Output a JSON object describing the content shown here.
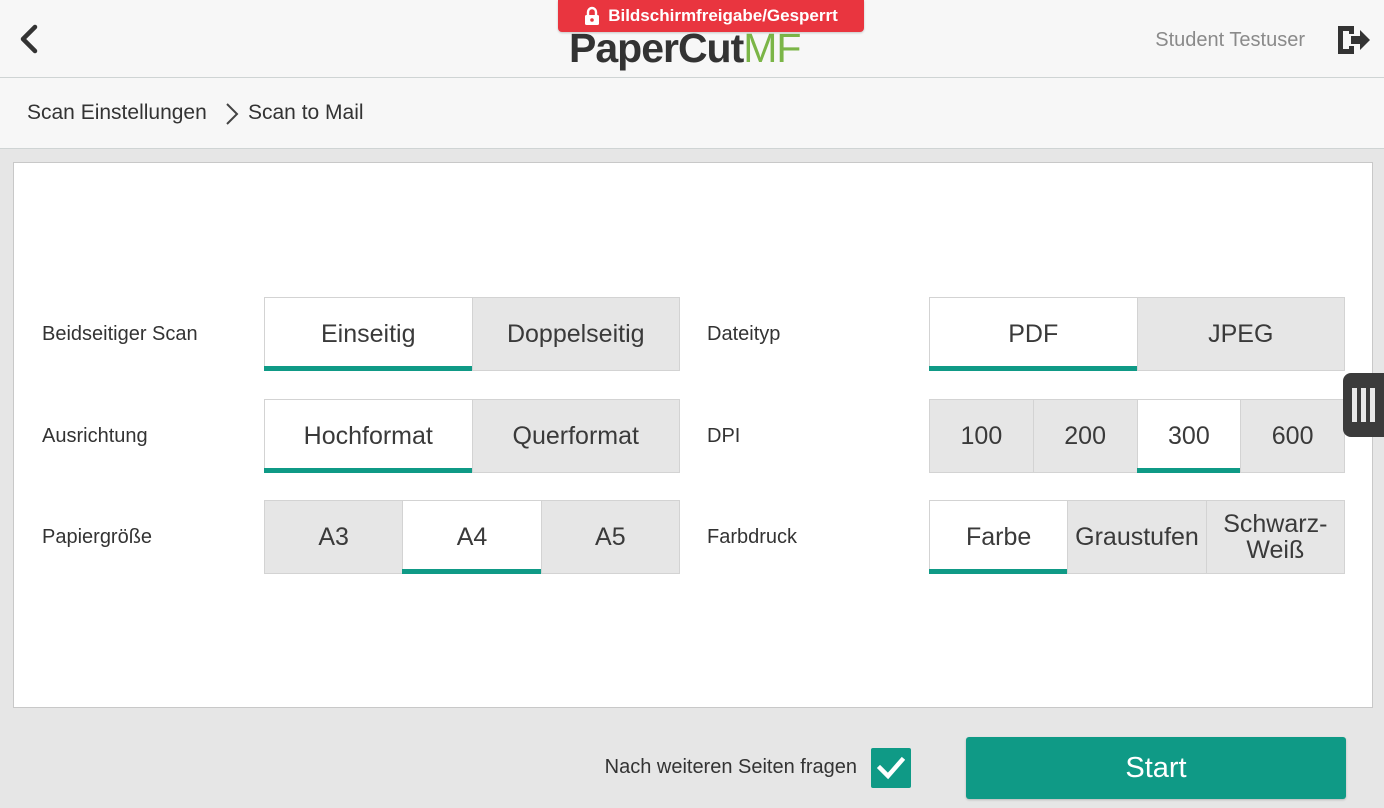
{
  "header": {
    "logo_main": "PaperCut",
    "logo_suffix": "MF",
    "lock_banner": "Bildschirmfreigabe/Gesperrt",
    "user_name": "Student Testuser",
    "icons": {
      "back": "chevron-left-icon",
      "lock": "lock-icon",
      "logout": "logout-icon"
    }
  },
  "breadcrumb": {
    "items": [
      "Scan Einstellungen",
      "Scan to Mail"
    ]
  },
  "settings": {
    "duplex": {
      "label": "Beidseitiger Scan",
      "options": [
        "Einseitig",
        "Doppelseitig"
      ],
      "selected": "Einseitig"
    },
    "orientation": {
      "label": "Ausrichtung",
      "options": [
        "Hochformat",
        "Querformat"
      ],
      "selected": "Hochformat"
    },
    "paper_size": {
      "label": "Papiergröße",
      "options": [
        "A3",
        "A4",
        "A5"
      ],
      "selected": "A4"
    },
    "file_type": {
      "label": "Dateityp",
      "options": [
        "PDF",
        "JPEG"
      ],
      "selected": "PDF"
    },
    "dpi": {
      "label": "DPI",
      "options": [
        "100",
        "200",
        "300",
        "600"
      ],
      "selected": "300"
    },
    "color": {
      "label": "Farbdruck",
      "options": [
        "Farbe",
        "Graustufen",
        "Schwarz-\nWeiß"
      ],
      "selected": "Farbe"
    }
  },
  "footer": {
    "ask_more_pages": "Nach weiteren Seiten fragen",
    "ask_more_pages_checked": true,
    "start_label": "Start"
  },
  "colors": {
    "accent": "#0f9a86",
    "lock_banner": "#e9353f",
    "logo_mf": "#7bb547"
  }
}
